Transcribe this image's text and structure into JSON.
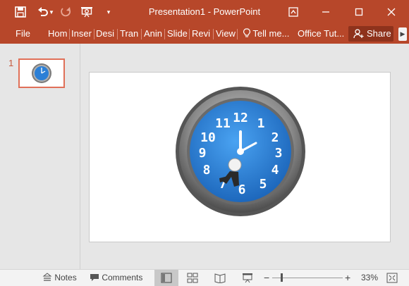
{
  "window": {
    "title": "Presentation1 - PowerPoint",
    "accent": "#b7472a"
  },
  "ribbon": {
    "tabs": [
      {
        "label": "File"
      },
      {
        "label": "Hom"
      },
      {
        "label": "Inser"
      },
      {
        "label": "Desi"
      },
      {
        "label": "Tran"
      },
      {
        "label": "Anin"
      },
      {
        "label": "Slide"
      },
      {
        "label": "Revi"
      },
      {
        "label": "View"
      }
    ],
    "tell_me": "Tell me...",
    "office_tutorials": "Office Tut...",
    "share": "Share"
  },
  "thumbnails": [
    {
      "number": "1",
      "selected": true
    }
  ],
  "clock": {
    "numbers": [
      "12",
      "1",
      "2",
      "3",
      "4",
      "5",
      "6",
      "7",
      "8",
      "9",
      "10",
      "11"
    ],
    "face_color": "#2b7fd6",
    "bezel_color": "#8a8a8a"
  },
  "statusbar": {
    "notes": "Notes",
    "comments": "Comments",
    "zoom": "33%"
  }
}
